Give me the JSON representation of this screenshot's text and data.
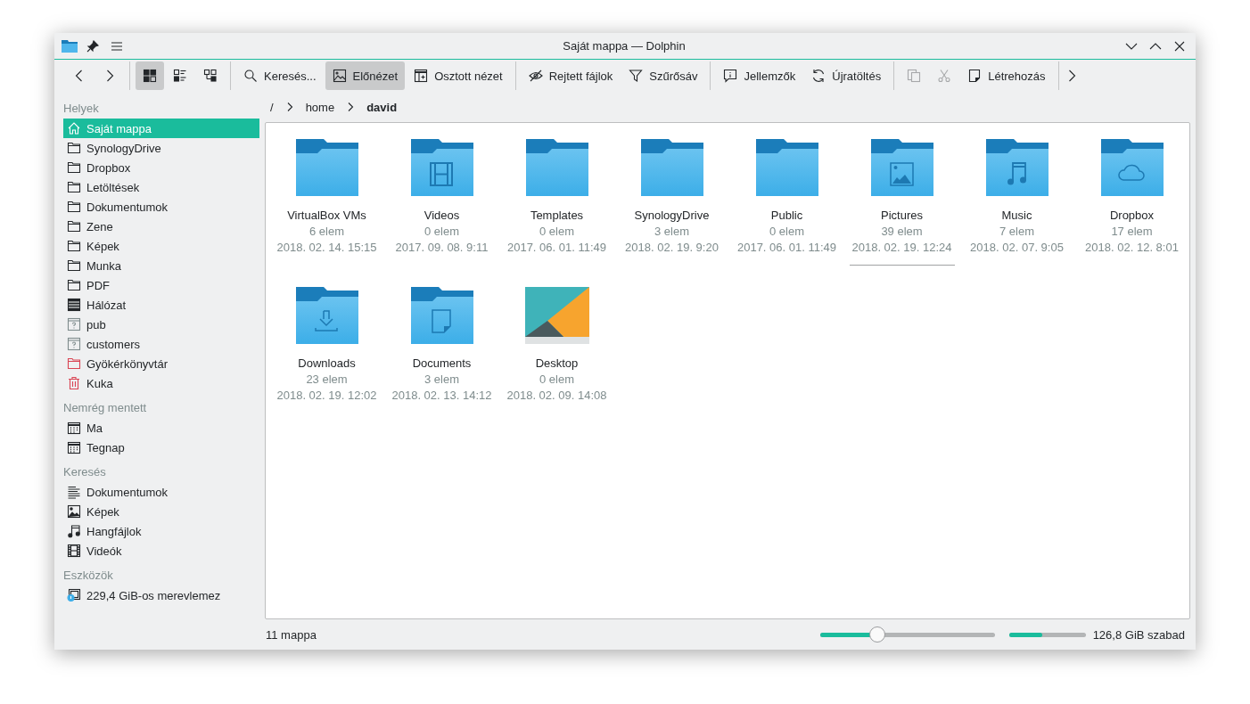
{
  "window": {
    "title": "Saját mappa — Dolphin"
  },
  "toolbar": {
    "groups": [
      {
        "items": [
          {
            "kind": "back",
            "selected": false,
            "disabled": false
          },
          {
            "kind": "forward",
            "selected": false,
            "disabled": false
          }
        ]
      },
      {
        "items": [
          {
            "kind": "icons",
            "selected": true,
            "disabled": false
          },
          {
            "kind": "details",
            "selected": false,
            "disabled": false
          },
          {
            "kind": "compact",
            "selected": false,
            "disabled": false
          }
        ]
      },
      {
        "items": [
          {
            "kind": "search",
            "label": "Keresés...",
            "selected": false,
            "disabled": false
          },
          {
            "kind": "preview",
            "label": "Előnézet",
            "selected": true,
            "disabled": false
          },
          {
            "kind": "split",
            "label": "Osztott nézet",
            "selected": false,
            "disabled": false
          }
        ]
      },
      {
        "items": [
          {
            "kind": "hidden",
            "label": "Rejtett fájlok",
            "selected": false,
            "disabled": false
          },
          {
            "kind": "filter",
            "label": "Szűrősáv",
            "selected": false,
            "disabled": false
          }
        ]
      },
      {
        "items": [
          {
            "kind": "properties",
            "label": "Jellemzők",
            "selected": false,
            "disabled": false
          },
          {
            "kind": "reload",
            "label": "Újratöltés",
            "selected": false,
            "disabled": false
          }
        ]
      },
      {
        "items": [
          {
            "kind": "copy",
            "selected": false,
            "disabled": true
          },
          {
            "kind": "cut",
            "selected": false,
            "disabled": true
          },
          {
            "kind": "create",
            "label": "Létrehozás",
            "selected": false,
            "disabled": false
          }
        ]
      }
    ]
  },
  "sidebar": {
    "sections": [
      {
        "title": "Helyek",
        "items": [
          {
            "label": "Saját mappa",
            "kind": "home",
            "selected": true
          },
          {
            "label": "SynologyDrive",
            "kind": "folder",
            "selected": false
          },
          {
            "label": "Dropbox",
            "kind": "folder",
            "selected": false
          },
          {
            "label": "Letöltések",
            "kind": "folder",
            "selected": false
          },
          {
            "label": "Dokumentumok",
            "kind": "folder",
            "selected": false
          },
          {
            "label": "Zene",
            "kind": "folder",
            "selected": false
          },
          {
            "label": "Képek",
            "kind": "folder",
            "selected": false
          },
          {
            "label": "Munka",
            "kind": "folder",
            "selected": false
          },
          {
            "label": "PDF",
            "kind": "folder",
            "selected": false
          },
          {
            "label": "Hálózat",
            "kind": "network",
            "selected": false
          },
          {
            "label": "pub",
            "kind": "unknown",
            "selected": false
          },
          {
            "label": "customers",
            "kind": "unknown",
            "selected": false
          },
          {
            "label": "Gyökérkönyvtár",
            "kind": "root",
            "selected": false
          },
          {
            "label": "Kuka",
            "kind": "trash",
            "selected": false
          }
        ]
      },
      {
        "title": "Nemrég mentett",
        "items": [
          {
            "label": "Ma",
            "kind": "calendar",
            "selected": false
          },
          {
            "label": "Tegnap",
            "kind": "calendar",
            "selected": false
          }
        ]
      },
      {
        "title": "Keresés",
        "items": [
          {
            "label": "Dokumentumok",
            "kind": "text",
            "selected": false
          },
          {
            "label": "Képek",
            "kind": "image",
            "selected": false
          },
          {
            "label": "Hangfájlok",
            "kind": "music",
            "selected": false
          },
          {
            "label": "Videók",
            "kind": "video",
            "selected": false
          }
        ]
      },
      {
        "title": "Eszközök",
        "items": [
          {
            "label": "229,4 GiB-os merevlemez",
            "kind": "drive",
            "selected": false
          }
        ]
      }
    ]
  },
  "breadcrumb": [
    {
      "label": "/",
      "current": false
    },
    {
      "label": "home",
      "current": false
    },
    {
      "label": "david",
      "current": true
    }
  ],
  "files": [
    {
      "name": "VirtualBox VMs",
      "count": "6 elem",
      "date": "2018. 02. 14. 15:15",
      "kind": "folder",
      "focused": false
    },
    {
      "name": "Videos",
      "count": "0 elem",
      "date": "2017. 09. 08. 9:11",
      "kind": "folder-video",
      "focused": false
    },
    {
      "name": "Templates",
      "count": "0 elem",
      "date": "2017. 06. 01. 11:49",
      "kind": "folder",
      "focused": false
    },
    {
      "name": "SynologyDrive",
      "count": "3 elem",
      "date": "2018. 02. 19. 9:20",
      "kind": "folder",
      "focused": false
    },
    {
      "name": "Public",
      "count": "0 elem",
      "date": "2017. 06. 01. 11:49",
      "kind": "folder",
      "focused": false
    },
    {
      "name": "Pictures",
      "count": "39 elem",
      "date": "2018. 02. 19. 12:24",
      "kind": "folder-image",
      "focused": true
    },
    {
      "name": "Music",
      "count": "7 elem",
      "date": "2018. 02. 07. 9:05",
      "kind": "folder-music",
      "focused": false
    },
    {
      "name": "Dropbox",
      "count": "17 elem",
      "date": "2018. 02. 12. 8:01",
      "kind": "folder-cloud",
      "focused": false
    },
    {
      "name": "Downloads",
      "count": "23 elem",
      "date": "2018. 02. 19. 12:02",
      "kind": "folder-download",
      "focused": false
    },
    {
      "name": "Documents",
      "count": "3 elem",
      "date": "2018. 02. 13. 14:12",
      "kind": "folder-document",
      "focused": false
    },
    {
      "name": "Desktop",
      "count": "0 elem",
      "date": "2018. 02. 09. 14:08",
      "kind": "thumbnail",
      "focused": false
    }
  ],
  "status_bar": {
    "text": "11 mappa",
    "zoom": {
      "level": 0.33
    },
    "space": {
      "level": 0.44,
      "text": "126,8 GiB szabad"
    }
  }
}
